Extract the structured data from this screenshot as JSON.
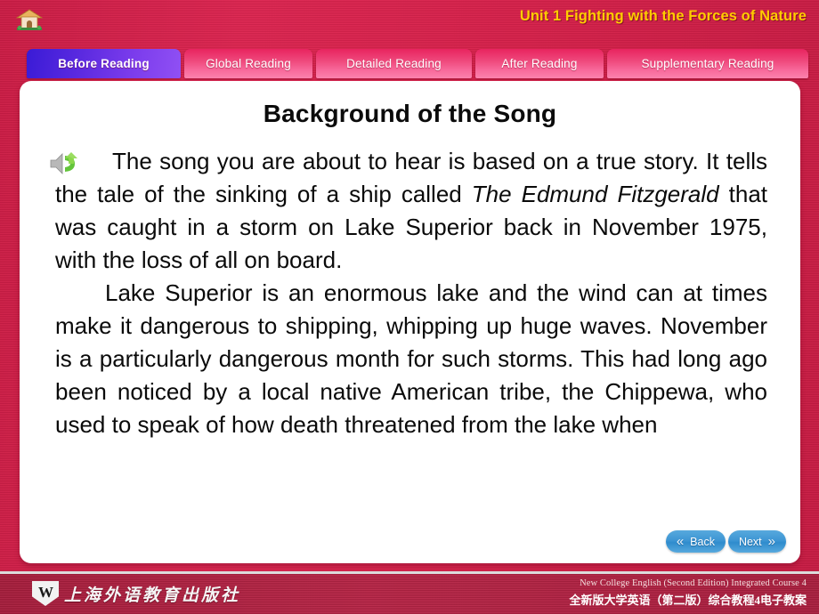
{
  "header": {
    "unit_title": "Unit 1 Fighting with the Forces of Nature",
    "home_icon": "home-icon",
    "title_color": "#ffcc00",
    "background_color": "#d31f4a"
  },
  "tabs": {
    "active_index": 0,
    "items": [
      {
        "label": "Before Reading",
        "active": true
      },
      {
        "label": "Global Reading",
        "active": false
      },
      {
        "label": "Detailed Reading",
        "active": false
      },
      {
        "label": "After Reading",
        "active": false
      },
      {
        "label": "Supplementary Reading",
        "active": false
      }
    ],
    "active_color": "#5b2ae0",
    "inactive_color": "#ef4a7d"
  },
  "content": {
    "title": "Background of the Song",
    "audio_icon": "speaker-icon",
    "paragraph1_part1": "The song you are about to hear is based on a true story. It tells the tale of the sinking of a ship called ",
    "paragraph1_italic": "The Edmund Fitzgerald",
    "paragraph1_part2": " that was caught in a storm on Lake Superior back in November 1975, with the loss of all on board.",
    "paragraph2": "Lake Superior is an enormous lake and the wind can at times make it dangerous to shipping, whipping up huge waves. November is a particularly dangerous month for such storms. This had long ago been noticed by a local native American tribe, the Chippewa, who used to speak of how death threatened from the lake when"
  },
  "navigation": {
    "back_label": "Back",
    "next_label": "Next",
    "back_chevron": "«",
    "next_chevron": "»",
    "button_color": "#3e96d4"
  },
  "footer": {
    "publisher_mark": "W",
    "publisher_name": "上海外语教育出版社",
    "course_english": "New College English (Second Edition) Integrated Course 4",
    "course_chinese": "全新版大学英语（第二版）综合教程4电子教案",
    "background_color": "#ae2040"
  }
}
